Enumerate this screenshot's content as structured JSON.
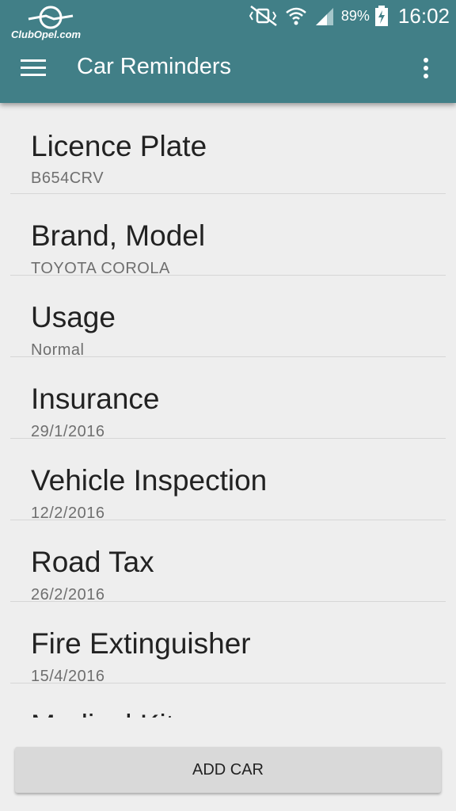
{
  "status_bar": {
    "logo_text": "ClubOpel.com",
    "battery_percent": "89%",
    "time": "16:02",
    "icons": [
      "mute-vibrate-icon",
      "wifi-icon",
      "signal-icon",
      "battery-charging-icon"
    ]
  },
  "app_bar": {
    "title": "Car Reminders",
    "background_color": "#417f87",
    "menu_icon": "hamburger-menu-icon",
    "overflow_icon": "more-vertical-icon"
  },
  "items": [
    {
      "title": "Licence Plate",
      "value": "B654CRV"
    },
    {
      "title": "Brand, Model",
      "value": "TOYOTA COROLA"
    },
    {
      "title": "Usage",
      "value": "Normal"
    },
    {
      "title": "Insurance",
      "value": "29/1/2016"
    },
    {
      "title": "Vehicle Inspection",
      "value": "12/2/2016"
    },
    {
      "title": "Road Tax",
      "value": "26/2/2016"
    },
    {
      "title": "Fire Extinguisher",
      "value": "15/4/2016"
    },
    {
      "title": "Medical Kit",
      "value": ""
    }
  ],
  "add_button": {
    "label": "ADD CAR"
  }
}
